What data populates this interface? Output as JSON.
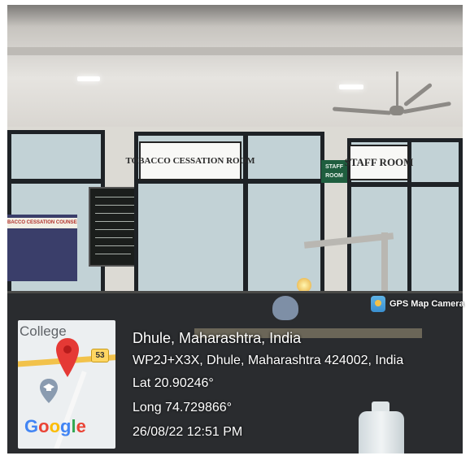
{
  "signs": {
    "tobacco_room": "TOBACCO CESSATION ROOM",
    "staff_room": "STAFF ROOM",
    "staff_small_line1": "STAFF",
    "staff_small_line2": "ROOM",
    "counseling": "BACCO CESSATION COUNSELING AREA"
  },
  "overlay": {
    "camera_label": "GPS Map Camera",
    "map": {
      "place_label": "College",
      "road_number": "53",
      "brand": [
        "G",
        "o",
        "o",
        "g",
        "l",
        "e"
      ],
      "brand_colors": [
        "#4285F4",
        "#EA4335",
        "#FBBC05",
        "#4285F4",
        "#34A853",
        "#EA4335"
      ],
      "pin_color": "#E53935",
      "icons": [
        "location-pin-icon",
        "graduation-cap-icon",
        "gps-camera-icon"
      ]
    },
    "title": "Dhule, Maharashtra, India",
    "address": "WP2J+X3X, Dhule, Maharashtra 424002, India",
    "latitude": "Lat 20.90246°",
    "longitude": "Long 74.729866°",
    "datetime": "26/08/22 12:51 PM"
  }
}
